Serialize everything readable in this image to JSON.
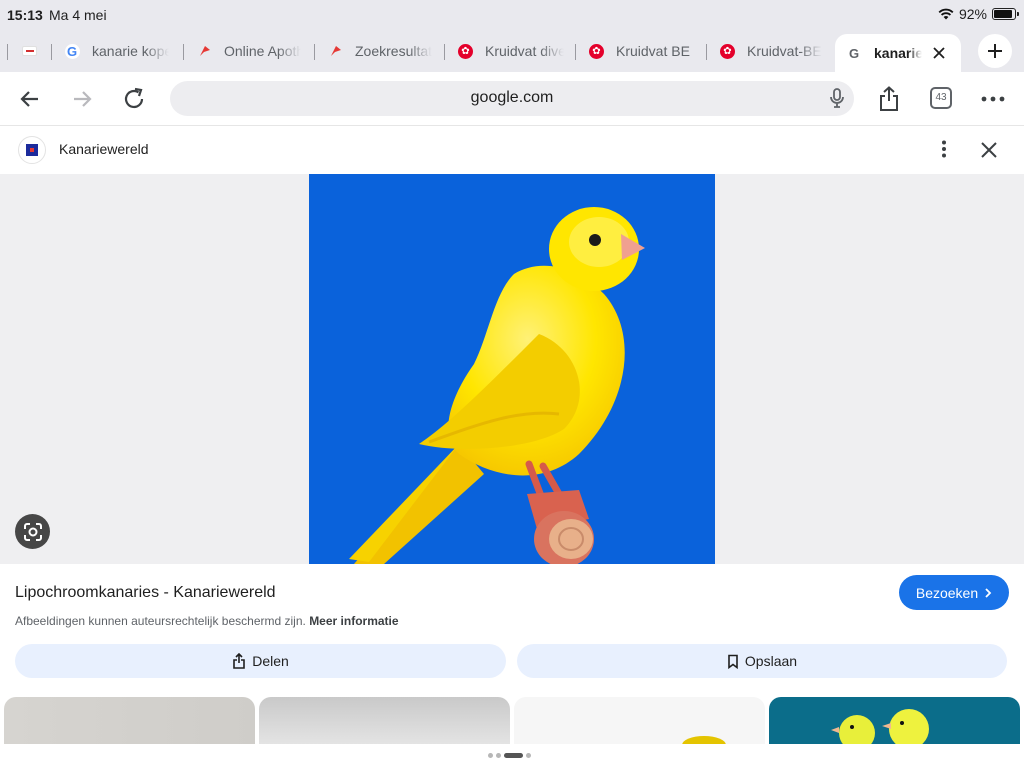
{
  "status": {
    "time": "15:13",
    "date": "Ma 4 mei",
    "battery": "92%",
    "battery_level": 0.92
  },
  "tabs": [
    {
      "label": "kanarie kopen",
      "icon": "google-icon"
    },
    {
      "label": "Online Apotheek",
      "icon": "apotheek-icon"
    },
    {
      "label": "Zoekresultaten",
      "icon": "apotheek-icon"
    },
    {
      "label": "Kruidvat diversen",
      "icon": "kruidvat-icon"
    },
    {
      "label": "Kruidvat BE",
      "icon": "kruidvat-icon"
    },
    {
      "label": "Kruidvat-BE",
      "icon": "kruidvat-icon"
    }
  ],
  "active_tab": {
    "label": "kanarie fe",
    "icon": "google-icon"
  },
  "toolbar": {
    "url": "google.com",
    "tab_count": "43"
  },
  "site": {
    "name": "Kanariewereld"
  },
  "result": {
    "title": "Lipochroomkanaries - Kanariewereld",
    "visit_label": "Bezoeken",
    "copyright_text": "Afbeeldingen kunnen auteursrechtelijk beschermd zijn.",
    "more_info_label": "Meer informatie",
    "share_label": "Delen",
    "save_label": "Opslaan"
  },
  "colors": {
    "accent": "#1a73e8",
    "photo_bg": "#0a62db",
    "canary_yellow": "#ffd600"
  }
}
